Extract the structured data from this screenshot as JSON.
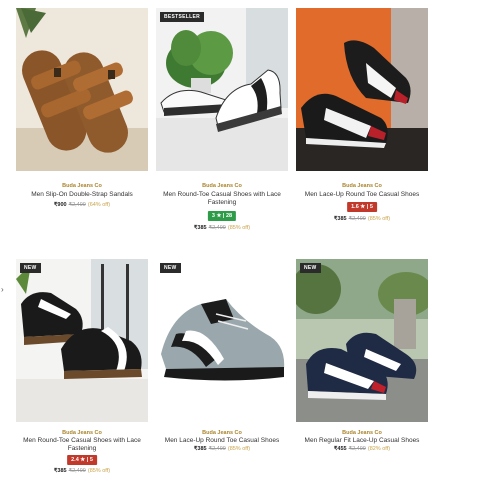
{
  "products": [
    {
      "badge": "",
      "brand": "Buda Jeans Co",
      "name": "Men Slip-On Double-Strap Sandals",
      "rating": "",
      "price": "₹900",
      "mrp": "₹2,499",
      "off": "(64% off)"
    },
    {
      "badge": "BESTSELLER",
      "brand": "Buda Jeans Co",
      "name": "Men Round-Toe Casual Shoes with Lace Fastening",
      "rating": "3 ★ | 28",
      "rating_color": "#2e9b48",
      "price": "₹385",
      "mrp": "₹2,499",
      "off": "(85% off)"
    },
    {
      "badge": "",
      "brand": "Buda Jeans Co",
      "name": "Men Lace-Up Round Toe Casual Shoes",
      "rating": "1.6 ★ | 5",
      "rating_color": "#c0392b",
      "price": "₹385",
      "mrp": "₹2,499",
      "off": "(85% off)"
    },
    {
      "badge": "NEW",
      "brand": "Buda Jeans Co",
      "name": "Men Round-Toe Casual Shoes with Lace Fastening",
      "rating": "2.4 ★ | 5",
      "rating_color": "#c0392b",
      "price": "₹385",
      "mrp": "₹2,499",
      "off": "(85% off)"
    },
    {
      "badge": "NEW",
      "brand": "Buda Jeans Co",
      "name": "Men Lace-Up Round Toe Casual Shoes",
      "rating": "",
      "price": "₹385",
      "mrp": "₹2,499",
      "off": "(85% off)"
    },
    {
      "badge": "NEW",
      "brand": "Buda Jeans Co",
      "name": "Men Regular Fit Lace-Up Casual Shoes",
      "rating": "",
      "price": "₹455",
      "mrp": "₹2,499",
      "off": "(82% off)"
    }
  ],
  "edge_mark": "›"
}
